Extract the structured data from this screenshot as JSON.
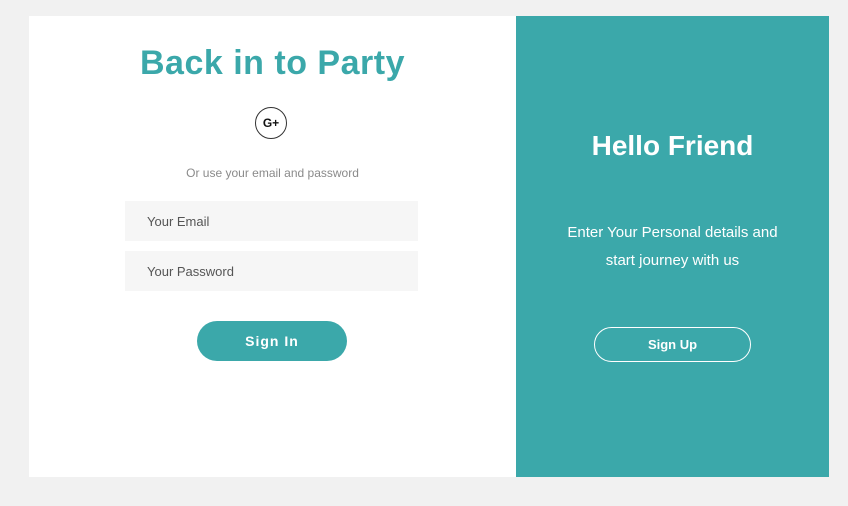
{
  "login": {
    "title": "Back in to Party",
    "social_icon": "google-plus-icon",
    "social_label": "G+",
    "hint": "Or use your email and password",
    "email_placeholder": "Your Email",
    "password_placeholder": "Your Password",
    "signin_label": "Sign In"
  },
  "promo": {
    "title": "Hello Friend",
    "text": "Enter Your Personal details and start journey with us",
    "signup_label": "Sign Up"
  },
  "colors": {
    "accent": "#3ba8aa",
    "background": "#f1f1f1",
    "input_background": "#f6f6f6"
  }
}
